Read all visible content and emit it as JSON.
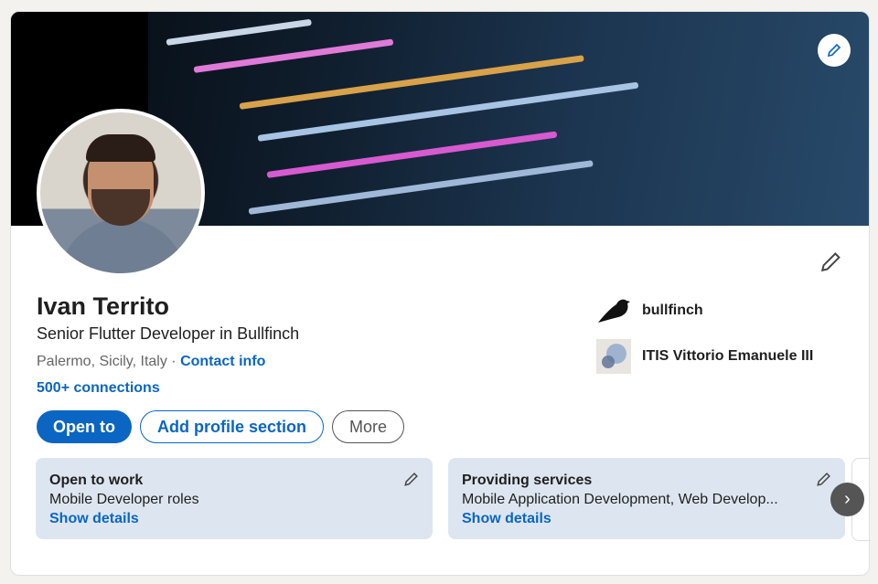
{
  "profile": {
    "name": "Ivan Territo",
    "headline": "Senior Flutter Developer in Bullfinch",
    "location": "Palermo, Sicily, Italy",
    "separator": " · ",
    "contact_info": "Contact info",
    "connections": "500+ connections"
  },
  "actions": {
    "open_to": "Open to",
    "add_section": "Add profile section",
    "more": "More"
  },
  "organizations": [
    {
      "name": "bullfinch",
      "icon": "bird-logo"
    },
    {
      "name": "ITIS Vittorio Emanuele III",
      "icon": "school-logo"
    }
  ],
  "panels": [
    {
      "title": "Open to work",
      "description": "Mobile Developer roles",
      "link": "Show details"
    },
    {
      "title": "Providing services",
      "description": "Mobile Application Development, Web Develop...",
      "link": "Show details"
    }
  ],
  "carousel_next": "›",
  "colors": {
    "accent": "#0a66c2",
    "panel_bg": "#dde6f0",
    "page_bg": "#f4f2ee"
  }
}
